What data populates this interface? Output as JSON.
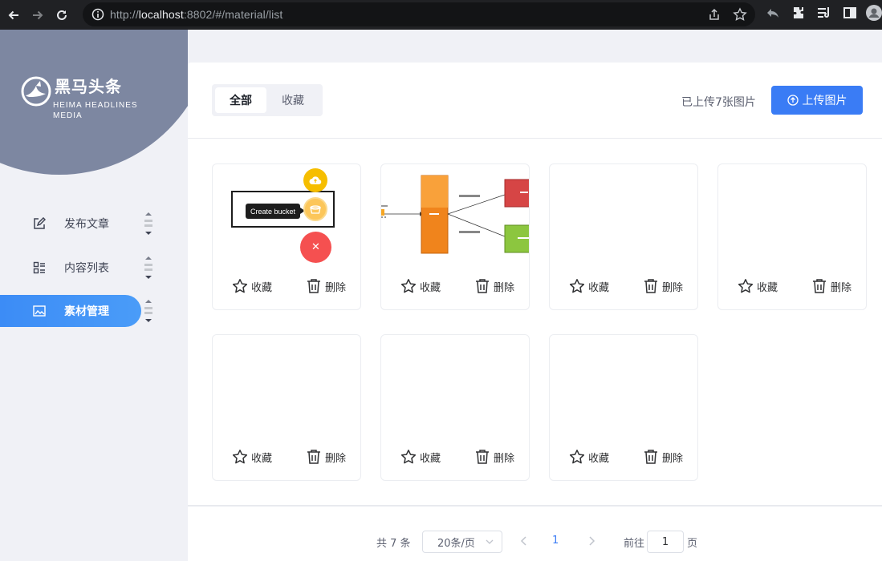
{
  "browser": {
    "url_scheme_host": "http://",
    "url_host": "localhost",
    "url_rest": ":8802/#/material/list"
  },
  "brand": {
    "name_cn": "黑马头条",
    "name_en_line1": "HEIMA HEADLINES",
    "name_en_line2": "MEDIA"
  },
  "sidebar": {
    "items": [
      {
        "label": "发布文章",
        "icon": "edit-icon",
        "active": false
      },
      {
        "label": "内容列表",
        "icon": "list-icon",
        "active": false
      },
      {
        "label": "素材管理",
        "icon": "image-icon",
        "active": true
      }
    ]
  },
  "toolbar": {
    "tab_all": "全部",
    "tab_fav": "收藏",
    "count_text": "已上传7张图片",
    "upload_label": "上传图片"
  },
  "cards": [
    {
      "fav": "收藏",
      "del": "删除",
      "thumb": "create-bucket"
    },
    {
      "fav": "收藏",
      "del": "删除",
      "thumb": "flow-diagram"
    },
    {
      "fav": "收藏",
      "del": "删除",
      "thumb": "blank"
    },
    {
      "fav": "收藏",
      "del": "删除",
      "thumb": "blank"
    },
    {
      "fav": "收藏",
      "del": "删除",
      "thumb": "blank"
    },
    {
      "fav": "收藏",
      "del": "删除",
      "thumb": "blank"
    },
    {
      "fav": "收藏",
      "del": "删除",
      "thumb": "blank"
    }
  ],
  "thumb1": {
    "tooltip": "Create bucket",
    "close_glyph": "✕"
  },
  "pagination": {
    "total": "共 7 条",
    "page_size": "20条/页",
    "current": "1",
    "goto_label": "前往",
    "goto_value": "1",
    "page_suffix": "页"
  },
  "colors": {
    "primary": "#3a7cf5",
    "sidebar_blob": "#7d87a1",
    "danger": "#f55050",
    "warning": "#f6be00"
  }
}
